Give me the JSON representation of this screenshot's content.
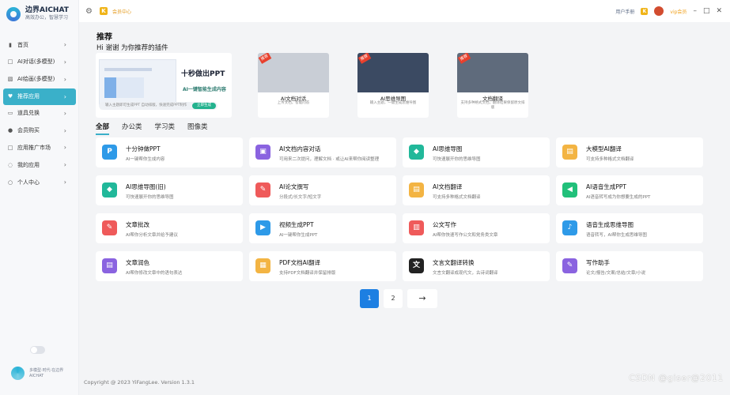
{
  "brand": {
    "title": "边界AICHAT",
    "subtitle": "高效办公，智慧学习"
  },
  "nav": [
    {
      "label": "首页",
      "icon": "▮"
    },
    {
      "label": "AI对话(多模型)",
      "icon": "□"
    },
    {
      "label": "AI绘画(多模型)",
      "icon": "▧"
    },
    {
      "label": "推荐应用",
      "icon": "♥",
      "active": true
    },
    {
      "label": "道具兑换",
      "icon": "▭"
    },
    {
      "label": "会员购买",
      "icon": "●"
    },
    {
      "label": "应用推广市场",
      "icon": "□"
    },
    {
      "label": "我的应用",
      "icon": "◌"
    },
    {
      "label": "个人中心",
      "icon": "○"
    }
  ],
  "sidebar_footer": "多模型·时代·在边界AICHAT",
  "topbar": {
    "badge": "K",
    "badge_text": "会员中心",
    "link": "用户手册",
    "k": "K",
    "vip": "vip会员",
    "min": "–",
    "max": "□",
    "close": "✕"
  },
  "section": {
    "title": "推荐",
    "subtitle": "Hi 谢谢 为你推荐的插件"
  },
  "featured_ppt": {
    "big": "十秒做出PPT",
    "mid": "AI一键智能生成内容",
    "bar": "输入主题即可生成PPT 自动排版，快速完成PPT制作",
    "btn": "立即生成"
  },
  "featured": [
    {
      "name": "AI文档对话",
      "desc": "上传文档，智能问答",
      "tag": "推荐",
      "color": "#c9ced6"
    },
    {
      "name": "AI思维导图",
      "desc": "输入主题，一键生成思维导图",
      "tag": "推荐",
      "color": "#3b4a62"
    },
    {
      "name": "文档翻译",
      "desc": "支持多种格式文档，翻译结果保留原文排版",
      "tag": "推荐",
      "color": "#5f6b7c"
    }
  ],
  "tabs": [
    "全部",
    "办公类",
    "学习类",
    "图像类"
  ],
  "cards": [
    {
      "title": "十分钟做PPT",
      "desc": "AI一键帮你生成内容",
      "icon": "P",
      "color": "#2e9ae8"
    },
    {
      "title": "AI文档内容对话",
      "desc": "可用来二次提问，理解文档 · 或让AI来帮你阅读整理",
      "icon": "▣",
      "color": "#8a63e0"
    },
    {
      "title": "AI思维导图",
      "desc": "可快速展开你的思维导图",
      "icon": "◆",
      "color": "#21b89a"
    },
    {
      "title": "大模型AI翻译",
      "desc": "可支持多种格式文档翻译",
      "icon": "▤",
      "color": "#f3b443"
    },
    {
      "title": "AI思维导图(旧)",
      "desc": "可快速展开你的思维导图",
      "icon": "◆",
      "color": "#21b89a"
    },
    {
      "title": "AI论文撰写",
      "desc": "分段式/长文字/短文字",
      "icon": "✎",
      "color": "#ef5a5a"
    },
    {
      "title": "AI文档翻译",
      "desc": "可支持多种格式文档翻译",
      "icon": "▤",
      "color": "#f3b443"
    },
    {
      "title": "AI语音生成PPT",
      "desc": "AI语音转写成为你想要生成的PPT",
      "icon": "◀",
      "color": "#21c07a"
    },
    {
      "title": "文章批改",
      "desc": "AI帮你分析文章并给予建议",
      "icon": "✎",
      "color": "#ef5a5a"
    },
    {
      "title": "视频生成PPT",
      "desc": "AI一键帮你生成PPT",
      "icon": "▶",
      "color": "#2e9ae8"
    },
    {
      "title": "公文写作",
      "desc": "AI帮你快速写作公文和党务类文章",
      "icon": "▥",
      "color": "#ef5a5a"
    },
    {
      "title": "语音生成思维导图",
      "desc": "语音转写，AI帮你生成思维导图",
      "icon": "♪",
      "color": "#2e9ae8"
    },
    {
      "title": "文章润色",
      "desc": "AI帮你修改文章中的语句表达",
      "icon": "▤",
      "color": "#8a63e0"
    },
    {
      "title": "PDF文档AI翻译",
      "desc": "支持PDF文档翻译并保留排版",
      "icon": "▦",
      "color": "#f3b443"
    },
    {
      "title": "文言文翻译转换",
      "desc": "文言文翻译成现代文，古诗词翻译",
      "icon": "文",
      "color": "#222222"
    },
    {
      "title": "写作助手",
      "desc": "论文/报告/文案/总结/文章/小说",
      "icon": "✎",
      "color": "#8a63e0"
    }
  ],
  "pager": {
    "p1": "1",
    "p2": "2",
    "next": "→"
  },
  "footer": "Copyright @ 2023 YiFangLee. Version 1.3.1",
  "watermark": "CSDN @giser@2011"
}
